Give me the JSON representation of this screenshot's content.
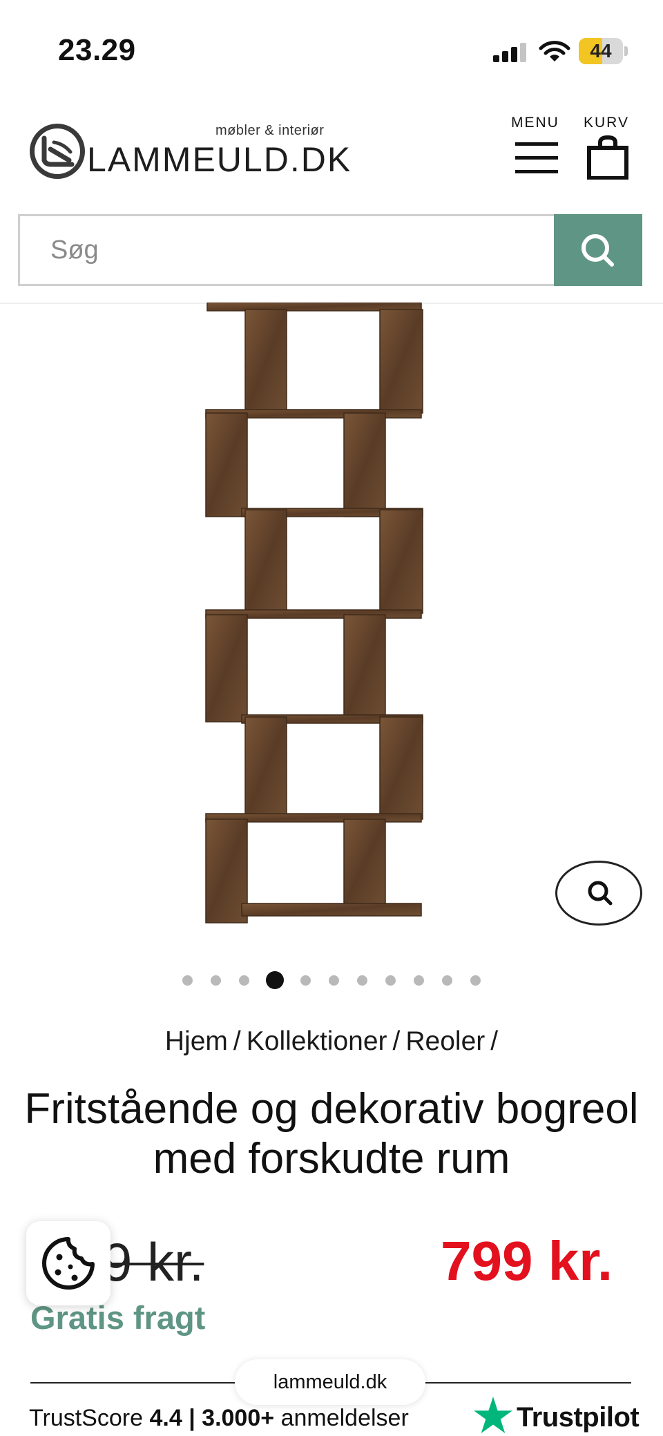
{
  "status_bar": {
    "time": "23.29",
    "battery": "44"
  },
  "header": {
    "logo_tagline": "møbler & interiør",
    "logo_text": "LAMMEULD.DK",
    "menu_label": "MENU",
    "cart_label": "KURV"
  },
  "search": {
    "placeholder": "Søg"
  },
  "gallery": {
    "dot_count": 11,
    "active_index": 3
  },
  "breadcrumb": {
    "items": [
      "Hjem",
      "Kollektioner",
      "Reoler"
    ],
    "separator": "/"
  },
  "product": {
    "title": "Fritstående og dekorativ bogreol med forskudte rum",
    "old_price_visible": "9 kr.",
    "new_price": "799 kr.",
    "shipping": "Gratis fragt"
  },
  "browser": {
    "url": "lammeuld.dk"
  },
  "trustpilot": {
    "prefix": "TrustScore",
    "score": "4.4",
    "pipe": "|",
    "count": "3.000+",
    "suffix": "anmeldelser",
    "brand": "Trustpilot"
  },
  "colors": {
    "accent": "#5f9584",
    "price": "#e3101e",
    "wood": "#6b4a30",
    "trustpilot_green": "#00b67a"
  }
}
